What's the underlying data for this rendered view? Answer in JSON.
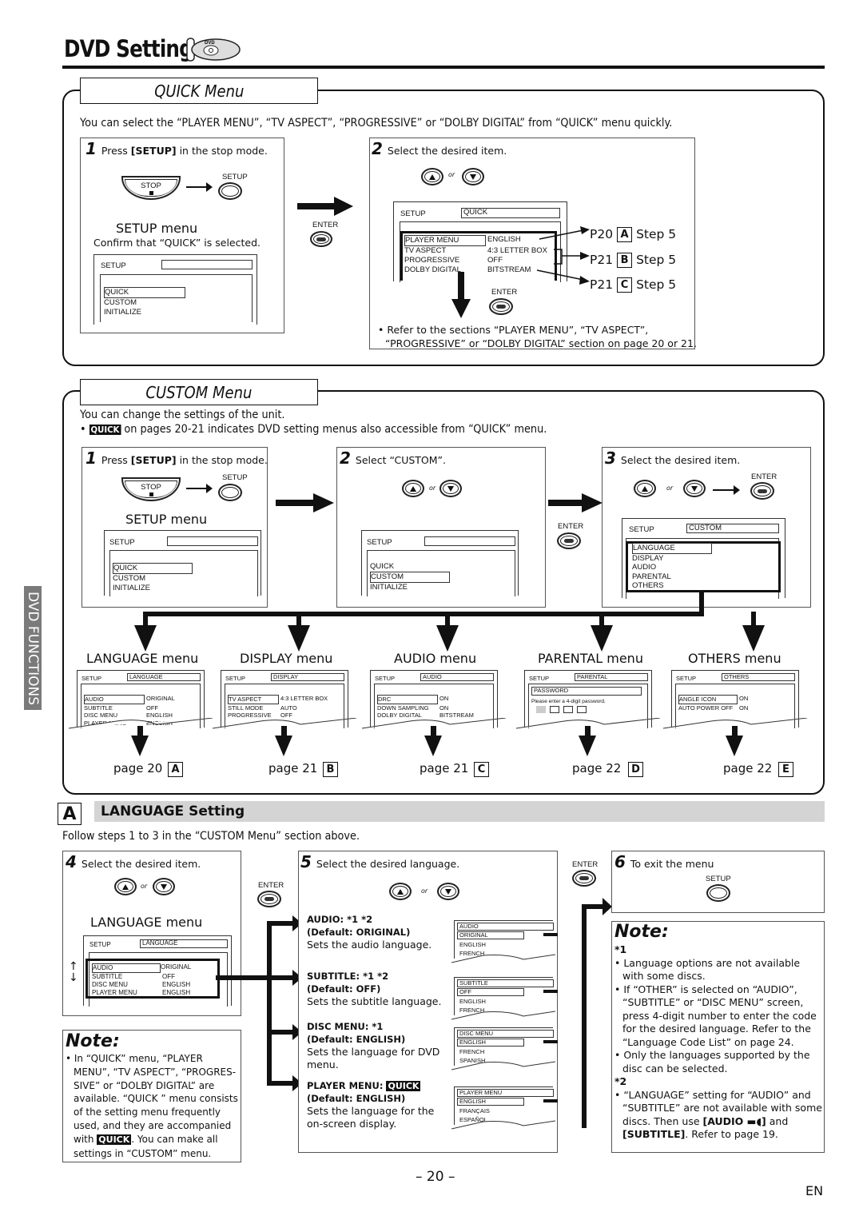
{
  "page": {
    "title": "DVD Setting",
    "icon": "dvd-disc-remote-icon",
    "side_tab": "DVD FUNCTIONS",
    "page_number": "– 20 –",
    "lang_code": "EN"
  },
  "quick": {
    "heading": "QUICK Menu",
    "intro": "You can select the “PLAYER MENU”, “TV ASPECT”, “PROGRESSIVE” or “DOLBY DIGITAL” from “QUICK” menu quickly.",
    "step1": {
      "num": "1",
      "text_pre": "Press ",
      "text_bold": "[SETUP]",
      "text_post": " in the stop mode.",
      "stop_label": "STOP",
      "setup_label": "SETUP",
      "menu_title": "SETUP menu",
      "confirm": "Confirm that “QUICK” is selected.",
      "screen": {
        "header": "SETUP",
        "header_value": "",
        "items": [
          "QUICK",
          "CUSTOM",
          "INITIALIZE"
        ],
        "selected": 0
      }
    },
    "enter_label": "ENTER",
    "step2": {
      "num": "2",
      "text": "Select the desired item.",
      "or": "or",
      "enter_label": "ENTER",
      "screen": {
        "header": "SETUP",
        "header_value": "QUICK",
        "rows": [
          {
            "item": "PLAYER MENU",
            "value": "ENGLISH"
          },
          {
            "item": "TV ASPECT",
            "value": "4:3 LETTER BOX"
          },
          {
            "item": "PROGRESSIVE",
            "value": "OFF"
          },
          {
            "item": "DOLBY DIGITAL",
            "value": "BITSTREAM"
          }
        ]
      },
      "refs": [
        {
          "page": "P20",
          "letter": "A",
          "step": "Step 5"
        },
        {
          "page": "P21",
          "letter": "B",
          "step": "Step 5"
        },
        {
          "page": "P21",
          "letter": "C",
          "step": "Step 5"
        }
      ],
      "note": "• Refer to the sections “PLAYER MENU”, “TV ASPECT”,",
      "note2": "“PROGRESSIVE” or “DOLBY DIGITAL” section on page 20 or 21."
    }
  },
  "custom": {
    "heading": "CUSTOM Menu",
    "intro": "You can change the settings of the unit.",
    "quick_tag": "QUICK",
    "quick_note": "on pages 20-21 indicates DVD setting menus also accessible from “QUICK” menu.",
    "step1": {
      "num": "1",
      "text_pre": "Press ",
      "text_bold": "[SETUP]",
      "text_post": " in the stop mode.",
      "stop_label": "STOP",
      "setup_label": "SETUP",
      "menu_title": "SETUP menu",
      "screen": {
        "header": "SETUP",
        "items": [
          "QUICK",
          "CUSTOM",
          "INITIALIZE"
        ],
        "selected": 0
      }
    },
    "step2": {
      "num": "2",
      "text": "Select “CUSTOM”.",
      "or": "or",
      "screen": {
        "header": "SETUP",
        "items": [
          "QUICK",
          "CUSTOM",
          "INITIALIZE"
        ],
        "selected": 1
      }
    },
    "enter_label": "ENTER",
    "step3": {
      "num": "3",
      "text": "Select the desired item.",
      "or": "or",
      "enter_label": "ENTER",
      "screen": {
        "header": "SETUP",
        "header_value": "CUSTOM",
        "items": [
          "LANGUAGE",
          "DISPLAY",
          "AUDIO",
          "PARENTAL",
          "OTHERS"
        ],
        "selected": 0
      }
    },
    "submenus": [
      {
        "title": "LANGUAGE menu",
        "header_value": "LANGUAGE",
        "rows": [
          [
            "AUDIO",
            "ORIGINAL"
          ],
          [
            "SUBTITLE",
            "OFF"
          ],
          [
            "DISC MENU",
            "ENGLISH"
          ],
          [
            "PLAYER MENU",
            "ENGLISH"
          ]
        ],
        "page": "page 20",
        "letter": "A"
      },
      {
        "title": "DISPLAY menu",
        "header_value": "DISPLAY",
        "rows": [
          [
            "TV ASPECT",
            "4:3 LETTER BOX"
          ],
          [
            "STILL MODE",
            "AUTO"
          ],
          [
            "PROGRESSIVE",
            "OFF"
          ]
        ],
        "page": "page 21",
        "letter": "B"
      },
      {
        "title": "AUDIO menu",
        "header_value": "AUDIO",
        "rows": [
          [
            "DRC",
            "ON"
          ],
          [
            "DOWN SAMPLING",
            "ON"
          ],
          [
            "DOLBY DIGITAL",
            "BITSTREAM"
          ]
        ],
        "page": "page 21",
        "letter": "C"
      },
      {
        "title": "PARENTAL menu",
        "header_value": "PARENTAL",
        "password_label": "PASSWORD",
        "password_prompt": "Please enter a 4-digit password.",
        "page": "page 22",
        "letter": "D"
      },
      {
        "title": "OTHERS menu",
        "header_value": "OTHERS",
        "rows": [
          [
            "ANGLE ICON",
            "ON"
          ],
          [
            "AUTO POWER OFF",
            "ON"
          ]
        ],
        "page": "page 22",
        "letter": "E"
      }
    ],
    "screen_header": "SETUP"
  },
  "language": {
    "letter": "A",
    "heading": "LANGUAGE Setting",
    "intro": "Follow steps 1 to 3 in the “CUSTOM Menu” section above.",
    "step4": {
      "num": "4",
      "text": "Select the desired item.",
      "or": "or",
      "menu_title": "LANGUAGE menu",
      "screen": {
        "header": "SETUP",
        "header_value": "LANGUAGE",
        "rows": [
          [
            "AUDIO",
            "ORIGINAL"
          ],
          [
            "SUBTITLE",
            "OFF"
          ],
          [
            "DISC MENU",
            "ENGLISH"
          ],
          [
            "PLAYER MENU",
            "ENGLISH"
          ]
        ]
      }
    },
    "enter_label": "ENTER",
    "step5": {
      "num": "5",
      "text": "Select the desired language.",
      "or": "or",
      "items": [
        {
          "title": "AUDIO: *1 *2",
          "default": "(Default: ORIGINAL)",
          "desc": "Sets the audio language.",
          "screen": [
            "AUDIO",
            "ORIGINAL",
            "ENGLISH",
            "FRENCH"
          ]
        },
        {
          "title": "SUBTITLE: *1 *2",
          "default": "(Default: OFF)",
          "desc": "Sets the subtitle language.",
          "screen": [
            "SUBTITLE",
            "OFF",
            "ENGLISH",
            "FRENCH"
          ]
        },
        {
          "title": "DISC MENU: *1",
          "default": "(Default: ENGLISH)",
          "desc": "Sets the language for DVD menu.",
          "screen": [
            "DISC MENU",
            "ENGLISH",
            "FRENCH",
            "SPANISH"
          ]
        },
        {
          "title": "PLAYER MENU:",
          "quick": "QUICK",
          "default": "(Default: ENGLISH)",
          "desc": "Sets the language for the on-screen display.",
          "screen": [
            "PLAYER MENU",
            "ENGLISH",
            "FRANÇAIS",
            "ESPAÑOL"
          ]
        }
      ]
    },
    "enter_label2": "ENTER",
    "step6": {
      "num": "6",
      "text": "To exit the menu",
      "setup_label": "SETUP"
    },
    "note_left": {
      "heading": "Note:",
      "text_a": "• In “QUICK” menu, “PLAYER MENU”, “TV ASPECT”, “PROGRES-SIVE” or “DOLBY DIGITAL” are available. “QUICK ” menu consists of the setting menu frequently used, and they are accompanied with ",
      "tag": "QUICK",
      "text_b": ". You can make all settings in “CUSTOM” menu."
    },
    "note_right": {
      "heading": "Note:",
      "mark1": "*1",
      "b1": "• Language options are not available with some discs.",
      "b2": "• If “OTHER” is selected on “AUDIO”, “SUBTITLE” or “DISC MENU” screen, press 4-digit number to enter the code for the desired language. Refer to the “Language Code List” on page 24.",
      "b3": "• Only the languages supported by the disc can be selected.",
      "mark2": "*2",
      "b4_pre": "• “LANGUAGE” setting for “AUDIO” and “SUBTITLE” are not available with some discs. Then use ",
      "b4_bold1": "[AUDIO ▬◖]",
      "b4_mid": " and ",
      "b4_bold2": "[SUBTITLE]",
      "b4_post": ". Refer to page 19."
    }
  }
}
